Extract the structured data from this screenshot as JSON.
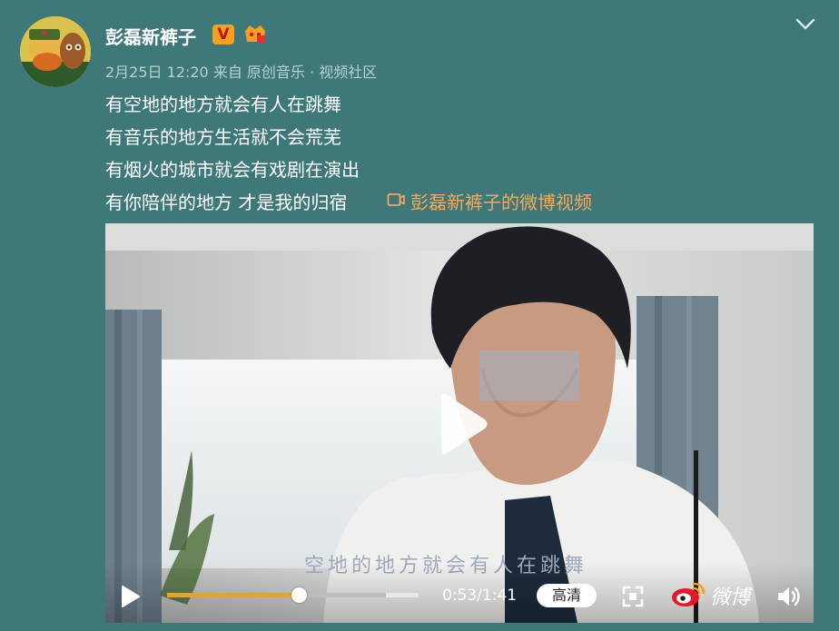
{
  "post": {
    "username": "彭磊新裤子",
    "verified_badge": "V",
    "timestamp": "2月25日 12:20",
    "source": "来自 原创音乐 · 视频社区",
    "lines": [
      "有空地的地方就会有人在跳舞",
      "有音乐的地方生活就不会荒芜",
      "有烟火的城市就会有戏剧在演出",
      "有你陪伴的地方 才是我的归宿"
    ],
    "video_link": "彭磊新裤子的微博视频"
  },
  "video": {
    "subtitle": "空地的地方就会有人在跳舞",
    "current_time": "0:53",
    "duration": "1:41",
    "time_display": "0:53/1:41",
    "progress_fraction": 0.525,
    "buffered_fraction": 0.87,
    "quality_label": "高清",
    "logo_text": "微博"
  },
  "icons": {
    "collapse": "chevron-down-icon",
    "play": "play-icon",
    "fullscreen": "fullscreen-icon",
    "volume": "volume-icon",
    "video_link": "video-link-icon",
    "weibo": "weibo-logo-icon"
  },
  "colors": {
    "background": "#3f7878",
    "link": "#f7a85a",
    "progress": "#f5a011",
    "meta_text": "#b9d0d0"
  }
}
